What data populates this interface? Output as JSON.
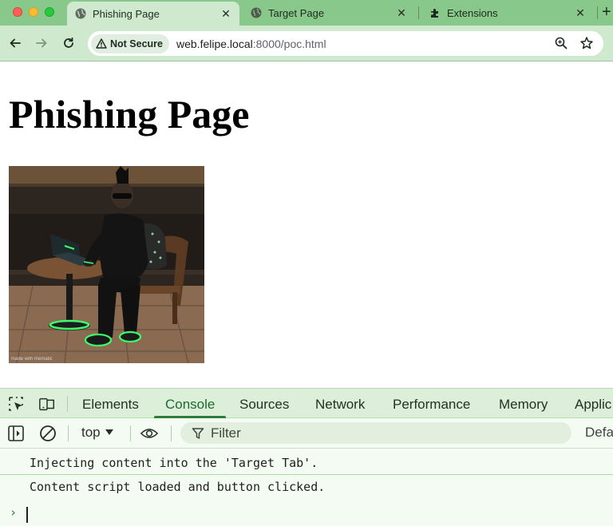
{
  "browser": {
    "tabs": [
      {
        "title": "Phishing Page",
        "active": true,
        "icon": "globe-icon"
      },
      {
        "title": "Target Page",
        "active": false,
        "icon": "globe-icon"
      },
      {
        "title": "Extensions",
        "active": false,
        "icon": "puzzle-icon"
      }
    ],
    "security_label": "Not Secure",
    "url_host": "web.felipe.local",
    "url_rest": ":8000/poc.html"
  },
  "page": {
    "heading": "Phishing Page"
  },
  "devtools": {
    "tabs": [
      "Elements",
      "Console",
      "Sources",
      "Network",
      "Performance",
      "Memory",
      "Applic"
    ],
    "active_tab": "Console",
    "context": "top",
    "filter_placeholder": "Filter",
    "levels_label": "Defa",
    "messages": [
      "Injecting content into the 'Target Tab'.",
      "Content script loaded and button clicked."
    ],
    "prompt_symbol": "›"
  },
  "colors": {
    "tabstrip": "#88c88a",
    "toolbar": "#cfe9cf",
    "accent": "#2f7d3a"
  }
}
